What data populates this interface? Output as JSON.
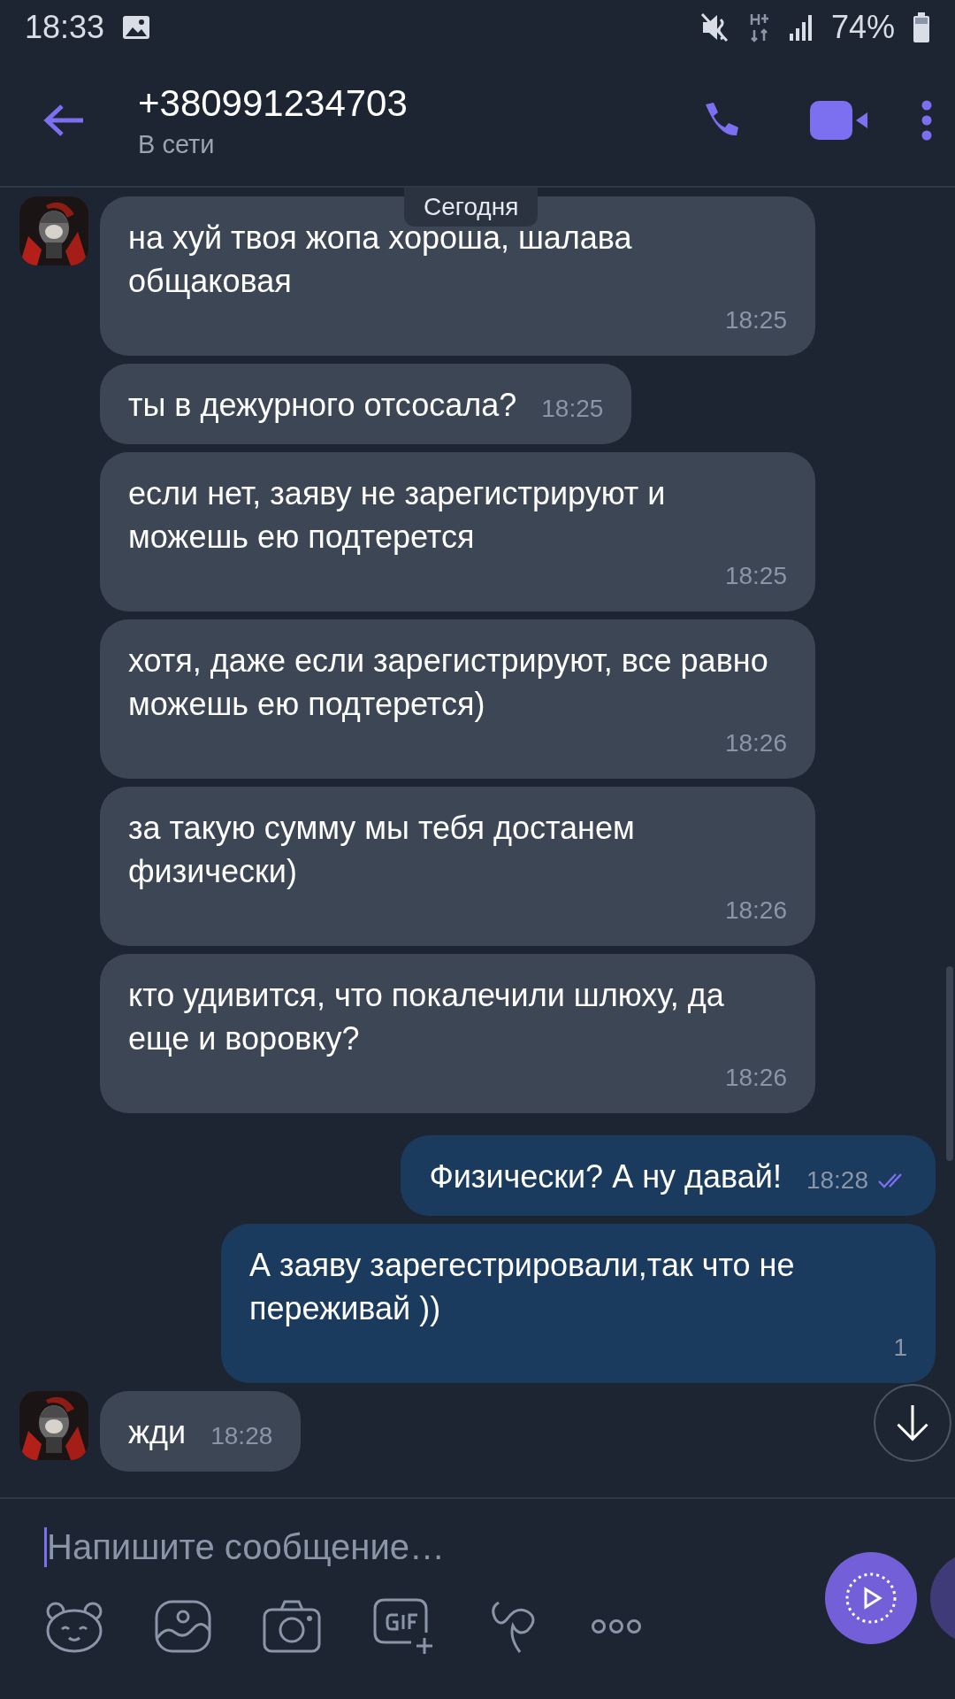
{
  "status_bar": {
    "time": "18:33",
    "battery": "74%"
  },
  "header": {
    "title": "+380991234703",
    "subtitle": "В сети"
  },
  "date_label": "Сегодня",
  "messages": [
    {
      "kind": "incoming",
      "avatar": true,
      "text": "на хуй твоя жопа хороша, шалава общаковая",
      "time": "18:25"
    },
    {
      "kind": "incoming",
      "avatar": false,
      "text": "ты в дежурного отсосала?",
      "time": "18:25"
    },
    {
      "kind": "incoming",
      "avatar": false,
      "text": "если нет, заяву не зарегистрируют и можешь ею подтерется",
      "time": "18:25"
    },
    {
      "kind": "incoming",
      "avatar": false,
      "text": "хотя, даже если зарегистрируют, все равно можешь ею подтерется)",
      "time": "18:26"
    },
    {
      "kind": "incoming",
      "avatar": false,
      "text": "за такую сумму мы тебя достанем физически)",
      "time": "18:26"
    },
    {
      "kind": "incoming",
      "avatar": false,
      "text": "кто удивится, что покалечили шлюху, да еще и воровку?",
      "time": "18:26"
    },
    {
      "kind": "outgoing",
      "avatar": false,
      "text": "Физически? А ну давай!",
      "time": "18:28",
      "read": true
    },
    {
      "kind": "outgoing",
      "avatar": false,
      "text": "А заяву зарегестрировали,так что не переживай ))",
      "time": "1"
    },
    {
      "kind": "incoming",
      "avatar": true,
      "text": "жди",
      "time": "18:28"
    }
  ],
  "composer": {
    "placeholder": "Напишите сообщение…"
  }
}
